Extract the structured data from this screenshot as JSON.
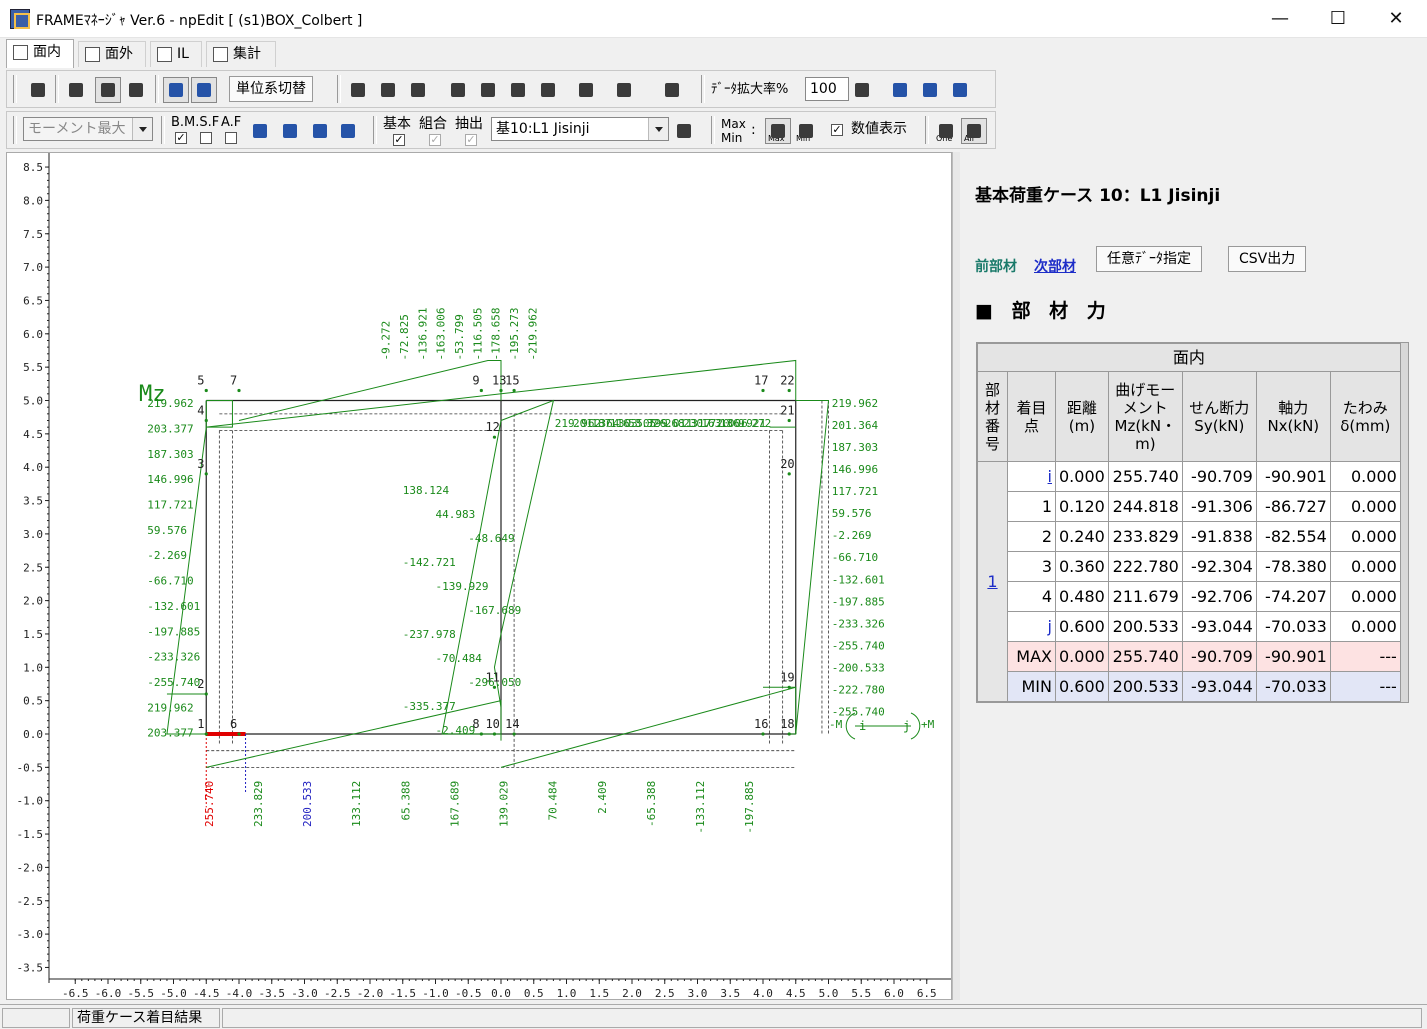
{
  "window": {
    "title": "FRAMEﾏﾈｰｼﾞｬ Ver.6 - npEdit [ (s1)BOX_Colbert ]",
    "minimize": "—",
    "maximize": "☐",
    "close": "✕"
  },
  "tabs": [
    {
      "label": "面内"
    },
    {
      "label": "面外"
    },
    {
      "label": "IL"
    },
    {
      "label": "集計"
    }
  ],
  "toolbar1": {
    "unit_button": "単位系切替",
    "zoom_label": "ﾃﾞｰﾀ拡大率%",
    "zoom_value": "100"
  },
  "toolbar2": {
    "force_select": "モーメント最大",
    "bmsf_label": "B.M.S.F",
    "af_label": "A.F",
    "kihon_label": "基本",
    "kumiai_label": "組合",
    "chushutsu_label": "抽出",
    "case_select": "基10:L1 Jisinji",
    "maxmin_label_top": "Max",
    "maxmin_label_bottom": "Min",
    "maxmin_colon": ":",
    "max_sub": "Max",
    "min_sub": "Min",
    "numeric_display": "数値表示",
    "check_mark": "✓",
    "one_sub": "One",
    "all_sub": "All"
  },
  "canvas": {
    "diagram_label": "Mz",
    "yticks": [
      "8.5",
      "8.0",
      "7.5",
      "7.0",
      "6.5",
      "6.0",
      "5.5",
      "5.0",
      "4.5",
      "4.0",
      "3.5",
      "3.0",
      "2.5",
      "2.0",
      "1.5",
      "1.0",
      "0.5",
      "0.0",
      "-0.5",
      "-1.0",
      "-1.5",
      "-2.0",
      "-2.5",
      "-3.0",
      "-3.5"
    ],
    "xticks": [
      "-6.5",
      "-6.0",
      "-5.5",
      "-5.0",
      "-4.5",
      "-4.0",
      "-3.5",
      "-3.0",
      "-2.5",
      "-2.0",
      "-1.5",
      "-1.0",
      "-0.5",
      "0.0",
      "0.5",
      "1.0",
      "1.5",
      "2.0",
      "2.5",
      "3.0",
      "3.5",
      "4.0",
      "4.5",
      "5.0",
      "5.5",
      "6.0",
      "6.5"
    ],
    "node_labels": [
      "1",
      "2",
      "3",
      "4",
      "5",
      "6",
      "7",
      "8",
      "9",
      "10",
      "11",
      "12",
      "13",
      "14",
      "15",
      "16",
      "17",
      "18",
      "19",
      "20",
      "21",
      "22"
    ],
    "sign_minus": "-M",
    "sign_plus": "+M",
    "sign_i": "i",
    "sign_j": "j"
  },
  "chart_data": {
    "type": "line",
    "title": "",
    "xlabel": "",
    "ylabel": "",
    "xlim": [
      -6.5,
      6.5
    ],
    "ylim": [
      -3.5,
      8.5
    ],
    "grid": false,
    "value_labels": {
      "top_beam": [
        "-9.272",
        "-72.825",
        "-136.921",
        "-163.006",
        "-53.799",
        "-116.505",
        "-178.658",
        "-195.273",
        "-219.962",
        "219.962",
        "201.364",
        "187.303",
        "116.505",
        "53.799",
        "326.011",
        "268.317",
        "230.720",
        "163.006",
        "136.921",
        "9.272"
      ],
      "left_wall": [
        "219.962",
        "203.377",
        "187.303",
        "146.996",
        "117.721",
        "59.576",
        "-2.269",
        "-66.710",
        "-132.601",
        "-197.885",
        "-233.326",
        "-255.740",
        "219.962",
        "203.377"
      ],
      "right_wall": [
        "219.962",
        "201.364",
        "187.303",
        "146.996",
        "117.721",
        "59.576",
        "-2.269",
        "-66.710",
        "-132.601",
        "-197.885",
        "-233.326",
        "-255.740",
        "-200.533",
        "-222.780",
        "-255.740"
      ],
      "middle_wall": [
        "138.124",
        "44.983",
        "-48.649",
        "-142.721",
        "-139.929",
        "-167.689",
        "-237.978",
        "-70.484",
        "-296.050",
        "-335.377",
        "-2.409"
      ],
      "bottom_beam": [
        "255.740",
        "233.829",
        "200.533",
        "133.112",
        "65.388",
        "167.689",
        "139.029",
        "70.484",
        "2.409",
        "-65.388",
        "-133.112",
        "-197.885"
      ]
    }
  },
  "right_panel": {
    "case_title": "基本荷重ケース 10：L1  Jisinji",
    "prev_member": "前部材",
    "next_member": "次部材",
    "arbitrary_button": "任意ﾃﾞｰﾀ指定",
    "csv_button": "CSV出力",
    "section_title": "■ 部 材 力"
  },
  "table": {
    "group_header": "面内",
    "headers": [
      "部材番号",
      "着目点",
      "距離(m)",
      "曲げモーメントMz(kN・m)",
      "せん断力Sy(kN)",
      "軸力Nx(kN)",
      "たわみδ(mm)"
    ],
    "member": "1",
    "rows": [
      {
        "point": "i",
        "dist": "0.000",
        "mz": "255.740",
        "sy": "-90.709",
        "nx": "-90.901",
        "defl": "0.000"
      },
      {
        "point": "1",
        "dist": "0.120",
        "mz": "244.818",
        "sy": "-91.306",
        "nx": "-86.727",
        "defl": "0.000"
      },
      {
        "point": "2",
        "dist": "0.240",
        "mz": "233.829",
        "sy": "-91.838",
        "nx": "-82.554",
        "defl": "0.000"
      },
      {
        "point": "3",
        "dist": "0.360",
        "mz": "222.780",
        "sy": "-92.304",
        "nx": "-78.380",
        "defl": "0.000"
      },
      {
        "point": "4",
        "dist": "0.480",
        "mz": "211.679",
        "sy": "-92.706",
        "nx": "-74.207",
        "defl": "0.000"
      },
      {
        "point": "j",
        "dist": "0.600",
        "mz": "200.533",
        "sy": "-93.044",
        "nx": "-70.033",
        "defl": "0.000"
      }
    ],
    "max": {
      "label": "MAX",
      "dist": "0.000",
      "mz": "255.740",
      "sy": "-90.709",
      "nx": "-90.901",
      "defl": "---"
    },
    "min": {
      "label": "MIN",
      "dist": "0.600",
      "mz": "200.533",
      "sy": "-93.044",
      "nx": "-70.033",
      "defl": "---"
    }
  },
  "status": {
    "pane2": "荷重ケース着目結果"
  },
  "colors": {
    "moment": "#1a8a1a",
    "frame": "#222222",
    "highlight": "#e00000",
    "min_value": "#2020c0"
  }
}
